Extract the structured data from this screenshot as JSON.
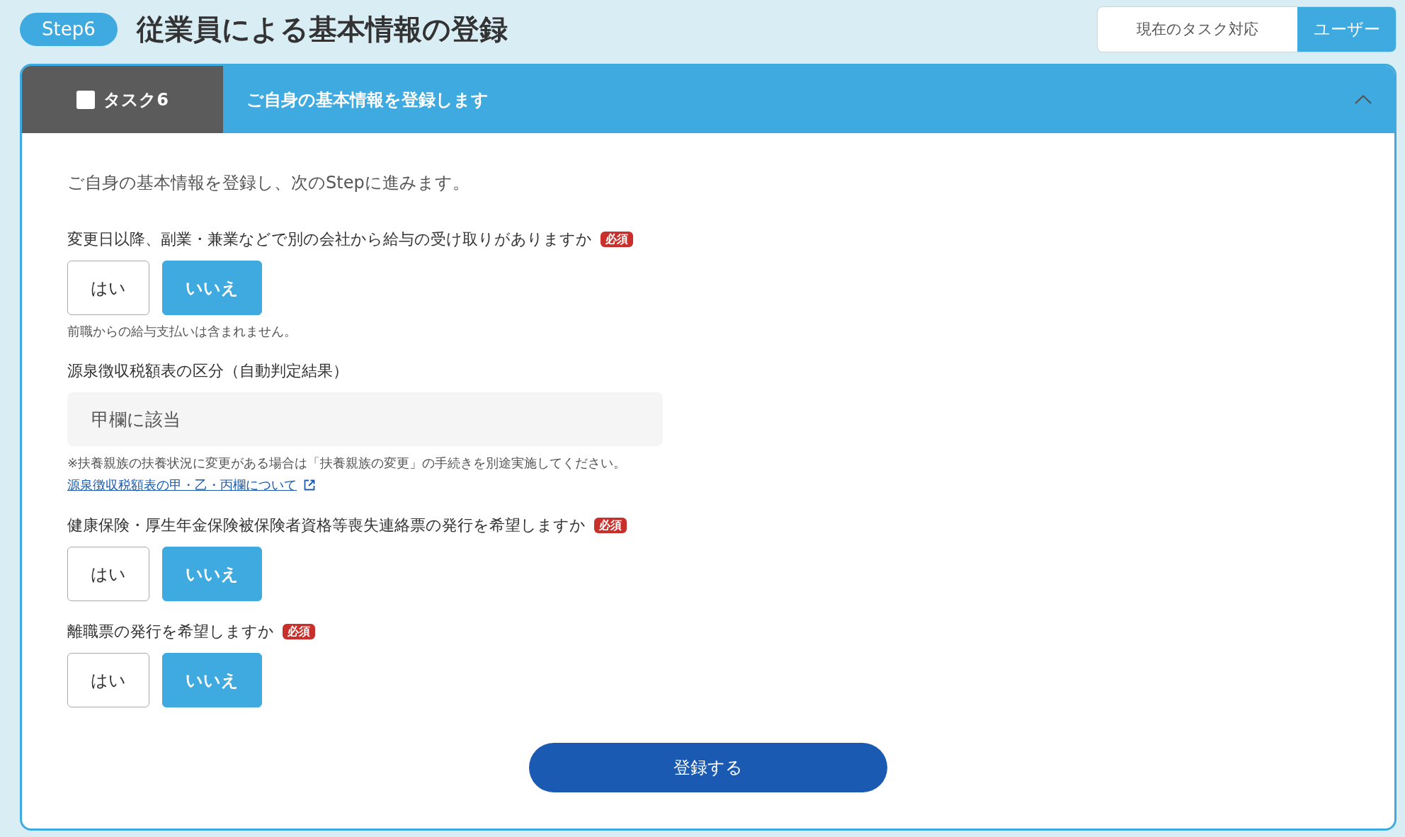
{
  "header": {
    "step_badge": "Step6",
    "title": "従業員による基本情報の登録",
    "task_owner": {
      "label": "現在のタスク対応",
      "value": "ユーザー"
    }
  },
  "task": {
    "tab_label": "タスク6",
    "checked": false,
    "title": "ご自身の基本情報を登録します",
    "expanded": true,
    "intro": "ご自身の基本情報を登録し、次のStepに進みます。",
    "fields": [
      {
        "kind": "choice",
        "label": "変更日以降、副業・兼業などで別の会社から給与の受け取りがありますか",
        "badge": "必須",
        "options": [
          {
            "label": "はい",
            "selected": false
          },
          {
            "label": "いいえ",
            "selected": true
          }
        ],
        "note": "前職からの給与支払いは含まれません。"
      },
      {
        "kind": "readonly",
        "label": "源泉徴収税額表の区分（自動判定結果）",
        "value": "甲欄に該当",
        "note": "※扶養親族の扶養状況に変更がある場合は「扶養親族の変更」の手続きを別途実施してください。",
        "link": "源泉徴収税額表の甲・乙・丙欄について"
      },
      {
        "kind": "choice",
        "label": "健康保険・厚生年金保険被保険者資格等喪失連絡票の発行を希望しますか",
        "badge": "必須",
        "options": [
          {
            "label": "はい",
            "selected": false
          },
          {
            "label": "いいえ",
            "selected": true
          }
        ]
      },
      {
        "kind": "choice",
        "label": "離職票の発行を希望しますか",
        "badge": "必須",
        "options": [
          {
            "label": "はい",
            "selected": false
          },
          {
            "label": "いいえ",
            "selected": true
          }
        ]
      }
    ],
    "submit": "登録する"
  }
}
